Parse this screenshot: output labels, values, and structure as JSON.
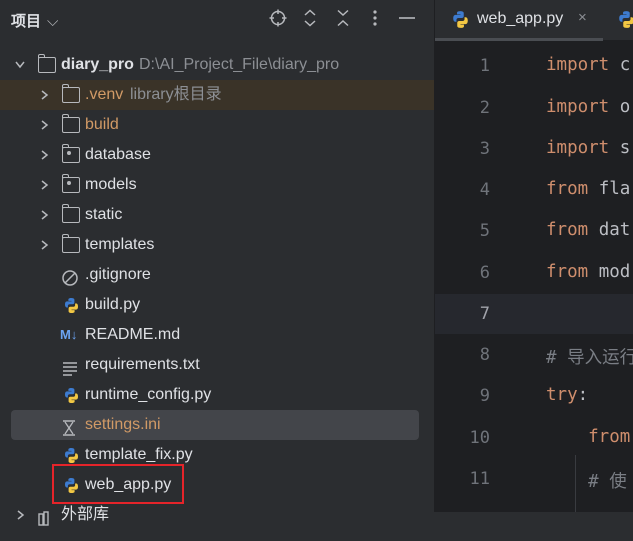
{
  "project_panel": {
    "title": "项目",
    "title_caret": "⌵",
    "header_icons": [
      "locate-icon",
      "expand-all-icon",
      "collapse-all-icon",
      "more-options-icon",
      "hide-icon"
    ],
    "tree": {
      "root": {
        "name": "diary_pro",
        "path": "D:\\AI_Project_File\\diary_pro"
      },
      "venv": {
        "name": ".venv",
        "annotation": "library根目录"
      },
      "folders": [
        "build",
        "database",
        "models",
        "static",
        "templates"
      ],
      "files": [
        ".gitignore",
        "build.py",
        "README.md",
        "requirements.txt",
        "runtime_config.py",
        "settings.ini",
        "template_fix.py",
        "web_app.py"
      ],
      "partial_next": "外部库"
    },
    "readme_badge": "M↓"
  },
  "editor": {
    "active_tab": "web_app.py",
    "tab_close": "×",
    "line_numbers": [
      "1",
      "2",
      "3",
      "4",
      "5",
      "6",
      "7",
      "8",
      "9",
      "10",
      "11"
    ],
    "current_line": "7",
    "lines": [
      {
        "kw": "import",
        "rest": " c"
      },
      {
        "kw": "import",
        "rest": " o"
      },
      {
        "kw": "import",
        "rest": " s"
      },
      {
        "kw": "from",
        "rest": " fla"
      },
      {
        "kw": "from",
        "rest": " dat"
      },
      {
        "kw": "from",
        "rest": " mod"
      },
      {
        "kw": "",
        "rest": ""
      },
      {
        "comment": "# 导入运行"
      },
      {
        "kw": "try",
        "rest": ":"
      },
      {
        "kw": "    from",
        "rest": ""
      },
      {
        "comment": "    # 使"
      }
    ]
  },
  "colors": {
    "panel_bg": "#2b2d30",
    "editor_bg": "#1e1f22",
    "keyword": "#cf8e6d",
    "excluded_folder": "#d19a66",
    "highlight_box": "#e5242a"
  }
}
